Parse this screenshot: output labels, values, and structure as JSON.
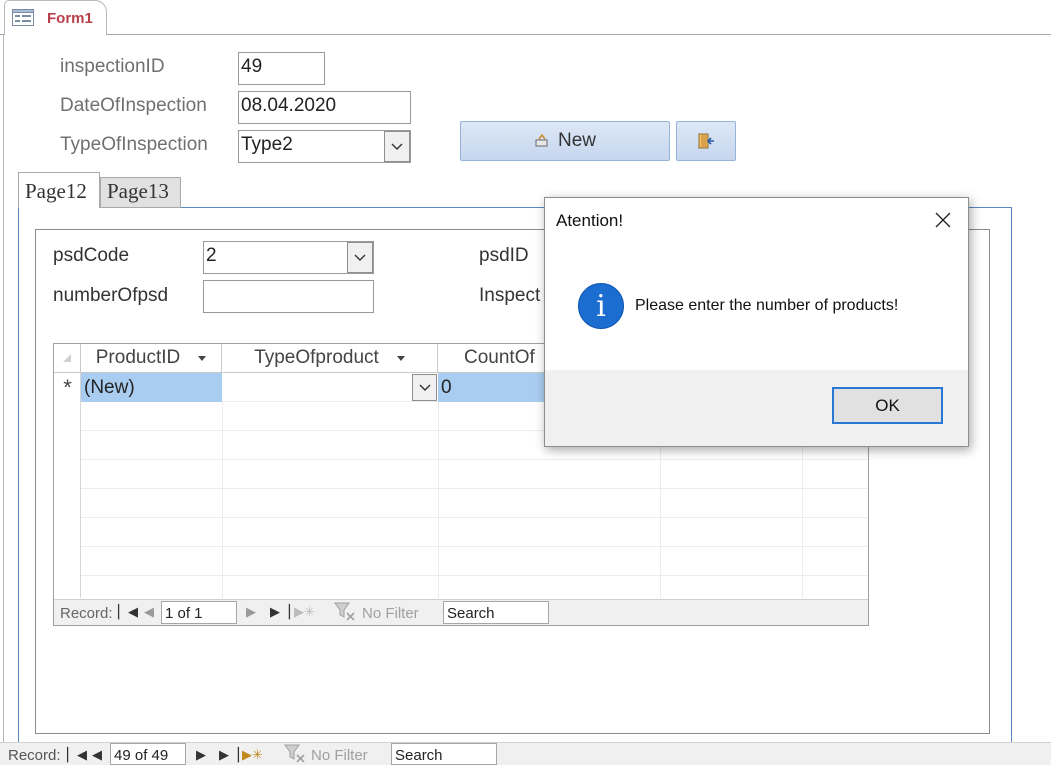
{
  "document": {
    "tab_title": "Form1"
  },
  "form": {
    "inspection_id": {
      "label": "inspectionID",
      "value": "49"
    },
    "date_of_inspection": {
      "label": "DateOfInspection",
      "value": "08.04.2020"
    },
    "type_of_inspection": {
      "label": "TypeOfInspection",
      "value": "Type2"
    },
    "new_button_label": "New",
    "tabs": [
      {
        "label": "Page12"
      },
      {
        "label": "Page13"
      }
    ]
  },
  "subform": {
    "psd_code": {
      "label": "psdCode",
      "value": "2"
    },
    "number_of_psd": {
      "label": "numberOfpsd",
      "value": ""
    },
    "psd_id_label": "psdID",
    "inspect_label": "Inspect",
    "datasheet": {
      "columns": [
        "ProductID",
        "TypeOfproduct",
        "CountOf"
      ],
      "new_row": {
        "product_id": "(New)",
        "type_of_product": "",
        "count": "0"
      }
    },
    "nav": {
      "record_label": "Record:",
      "position": "1 of 1",
      "filter_label": "No Filter",
      "search_label": "Search"
    }
  },
  "record_nav": {
    "record_label": "Record:",
    "position": "49 of 49",
    "filter_label": "No Filter",
    "search_label": "Search"
  },
  "dialog": {
    "title": "Atention!",
    "message": "Please enter the number of products!",
    "ok_label": "OK",
    "icon": "info-icon"
  },
  "colors": {
    "accent": "#b8404a",
    "selection": "#a9cdf0",
    "info_blue": "#1c6dd0",
    "tab_border": "#5b87c5"
  }
}
